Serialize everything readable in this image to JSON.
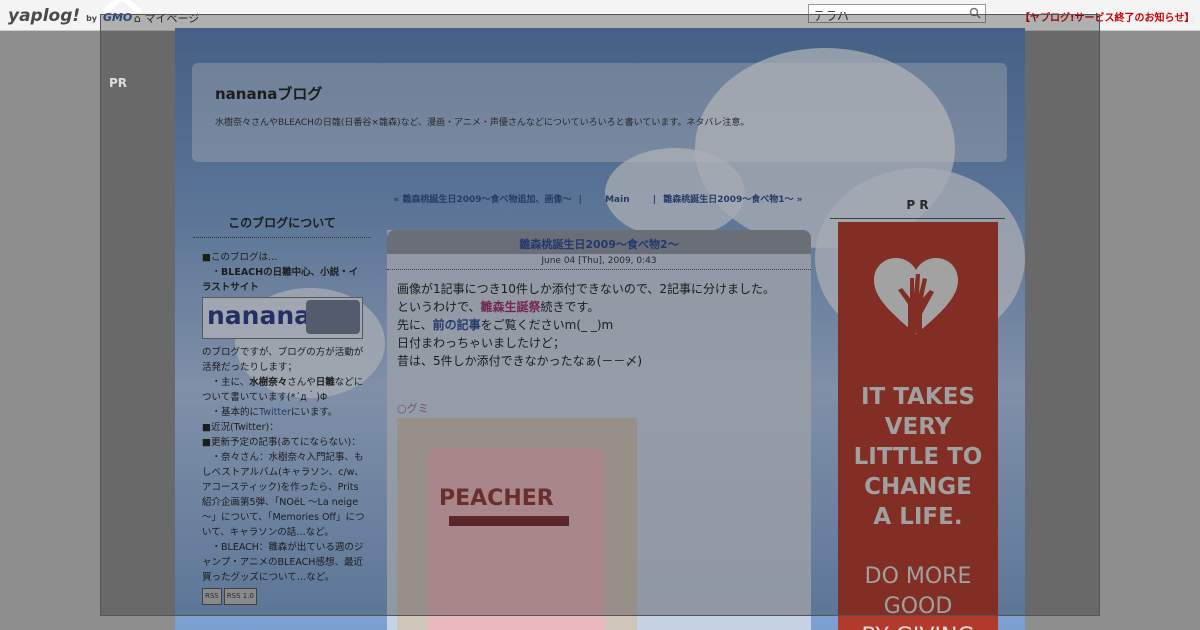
{
  "topbar": {
    "logo": "yaplog!",
    "logo_by": "by",
    "logo_gmo": "GMO",
    "mypage": "マイページ",
    "search_value": "テラハ",
    "notice": "【ヤプログ!サービス終了のお知らせ】"
  },
  "overlay": {
    "pr": "PR"
  },
  "header": {
    "title": "nananaブログ",
    "description": "水樹奈々さんやBLEACHの日雛(日番谷×雛森)など、漫画・アニメ・声優さんなどについていろいろと書いています。ネタバレ注意。"
  },
  "sidebar": {
    "heading": "このブログについて",
    "p1": "■このブログは…",
    "p2a": "・",
    "p2b": "BLEACHの日雛中心、小説・イラストサイト",
    "image_text": "nanana",
    "p3": "のブログですが、ブログの方が活動が活発だったりします；",
    "p4a": "・主に、",
    "p4b": "水樹奈々",
    "p4c": "さんや",
    "p4d": "日雛",
    "p4e": "などについて書いています(*´д｀)Φ",
    "p5a": "・基本的に",
    "p5b": "Twitter",
    "p5c": "にいます。",
    "p6": "■近況(Twitter)：",
    "p7": "■更新予定の記事(あてにならない)：",
    "p8": "・奈々さん：水樹奈々入門記事、もしベストアルバム(キャラソン、c/w、アコースティック)を作ったら、Prits紹介企画第5弾、「NOëL ～La neige～」について、「Memories Off」について、キャラソンの話…など。",
    "p9": "・BLEACH：雛森が出ている週のジャンプ・アニメのBLEACH感想、最近買ったグッズについて…など。",
    "rss1": "RSS",
    "rss2": "RSS 1.0"
  },
  "pager": {
    "prev": "« 雛森桃誕生日2009～食べ物追加、画像～",
    "main": "Main",
    "next": "雛森桃誕生日2009～食べ物1～ »",
    "sep": "|"
  },
  "entry": {
    "title": "雛森桃誕生日2009～食べ物2～",
    "date": "June 04 [Thu], 2009, 0:43",
    "l1": "画像が1記事につき10件しか添付できないので、2記事に分けました。",
    "l2a": "というわけで、",
    "l2b": "雛森生誕祭",
    "l2c": "続きです。",
    "l3a": "先に、",
    "l3b": "前の記事",
    "l3c": "をご覧くださいm(_ _)m",
    "l4": "日付まわっちゃいましたけど；",
    "l5": "昔は、5件しか添付できなかったなぁ(－－〆)",
    "gumi": "○グミ",
    "photo_brand": "PEACHER"
  },
  "right": {
    "pr": "P R",
    "ad_line1": "IT TAKES",
    "ad_line2": "VERY",
    "ad_line3": "LITTLE TO",
    "ad_line4": "CHANGE",
    "ad_line5": "A LIFE.",
    "ad_sub1": "DO MORE",
    "ad_sub2": "GOOD",
    "ad_sub3": "BY GIVING"
  },
  "colors": {
    "ad_bg": "#b23a2c",
    "notice": "#cc0000",
    "link": "#284a96"
  }
}
